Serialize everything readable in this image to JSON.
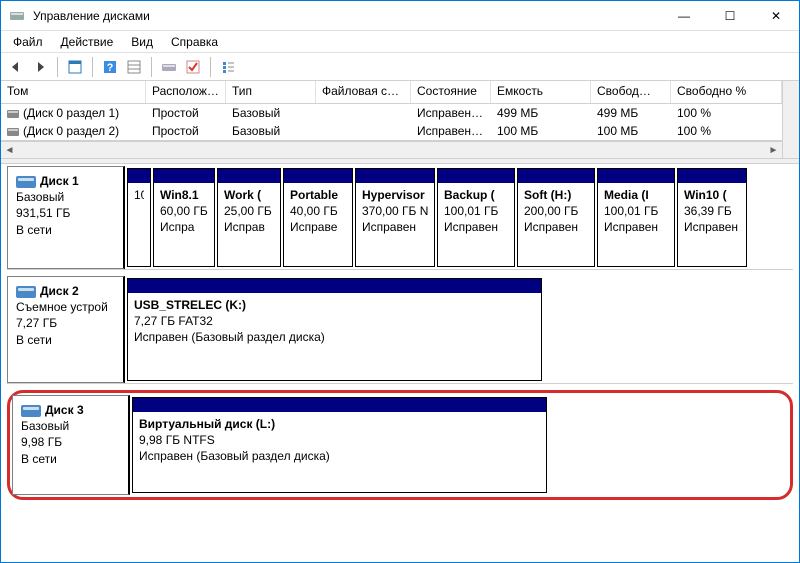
{
  "window": {
    "title": "Управление дисками",
    "btn_min": "—",
    "btn_max": "☐",
    "btn_close": "✕"
  },
  "menu": {
    "file": "Файл",
    "action": "Действие",
    "view": "Вид",
    "help": "Справка"
  },
  "volumes": {
    "headers": {
      "tom": "Том",
      "layout": "Располож…",
      "type": "Тип",
      "fs": "Файловая с…",
      "status": "Состояние",
      "capacity": "Емкость",
      "free": "Свобод…",
      "free_pc": "Свободно %"
    },
    "rows": [
      {
        "tom": "(Диск 0 раздел 1)",
        "layout": "Простой",
        "type": "Базовый",
        "fs": "",
        "status": "Исправен…",
        "capacity": "499 МБ",
        "free": "499 МБ",
        "free_pc": "100 %"
      },
      {
        "tom": "(Диск 0 раздел 2)",
        "layout": "Простой",
        "type": "Базовый",
        "fs": "",
        "status": "Исправен…",
        "capacity": "100 МБ",
        "free": "100 МБ",
        "free_pc": "100 %"
      }
    ]
  },
  "disks": [
    {
      "name": "Диск 1",
      "type": "Базовый",
      "size": "931,51 ГБ",
      "status": "В сети",
      "partitions": [
        {
          "name": "",
          "size": "10",
          "status": ""
        },
        {
          "name": "Win8.1",
          "size": "60,00 ГБ",
          "status": "Испра"
        },
        {
          "name": "Work  (",
          "size": "25,00 ГБ",
          "status": "Исправ"
        },
        {
          "name": "Portable",
          "size": "40,00 ГБ",
          "status": "Исправе"
        },
        {
          "name": "Hypervisor",
          "size": "370,00 ГБ N",
          "status": "Исправен"
        },
        {
          "name": "Backup  (",
          "size": "100,01 ГБ",
          "status": "Исправен"
        },
        {
          "name": "Soft  (H:)",
          "size": "200,00 ГБ",
          "status": "Исправен"
        },
        {
          "name": "Media  (I",
          "size": "100,01 ГБ",
          "status": "Исправен"
        },
        {
          "name": "Win10  (",
          "size": "36,39 ГБ",
          "status": "Исправен"
        }
      ]
    },
    {
      "name": "Диск 2",
      "type": "Съемное устрой",
      "size": "7,27 ГБ",
      "status": "В сети",
      "partition": {
        "name": "USB_STRELEC  (K:)",
        "size": "7,27 ГБ FAT32",
        "status": "Исправен (Базовый раздел диска)"
      }
    },
    {
      "name": "Диск 3",
      "type": "Базовый",
      "size": "9,98 ГБ",
      "status": "В сети",
      "partition": {
        "name": "Виртуальный диск  (L:)",
        "size": "9,98 ГБ NTFS",
        "status": "Исправен (Базовый раздел диска)"
      }
    }
  ]
}
